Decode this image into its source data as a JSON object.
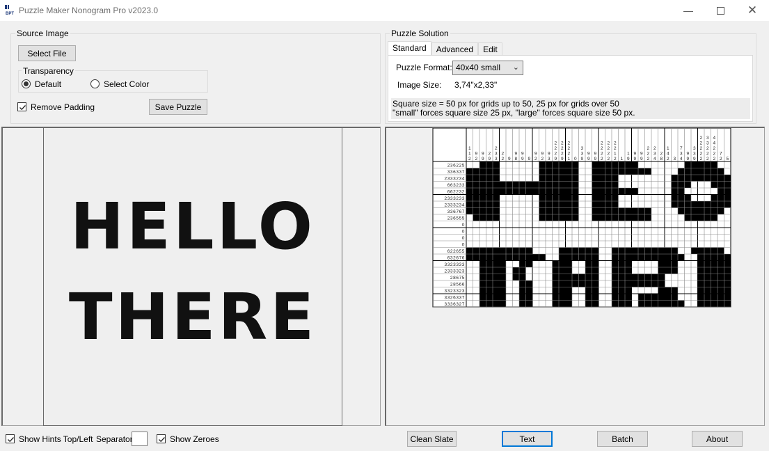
{
  "window": {
    "title": "Puzzle Maker Nonogram Pro v2023.0",
    "icon": "app-logo-icon",
    "icon_text": "BPT",
    "controls": [
      "minimize-icon",
      "maximize-icon",
      "close-icon"
    ]
  },
  "source_image": {
    "group_title": "Source Image",
    "select_file_label": "Select File",
    "transparency": {
      "title": "Transparency",
      "options": [
        {
          "label": "Default",
          "selected": true
        },
        {
          "label": "Select Color",
          "selected": false
        }
      ]
    },
    "remove_padding": {
      "label": "Remove Padding",
      "checked": true
    },
    "save_puzzle_label": "Save Puzzle",
    "preview_text": [
      "HELLO",
      "THERE"
    ]
  },
  "puzzle_solution": {
    "group_title": "Puzzle Solution",
    "tabs": [
      {
        "label": "Standard",
        "active": true
      },
      {
        "label": "Advanced",
        "active": false
      },
      {
        "label": "Edit",
        "active": false
      }
    ],
    "puzzle_format_label": "Puzzle Format:",
    "puzzle_format_value": "40x40 small",
    "image_size_label": "Image Size:",
    "image_size_value": "3,74\"x2,33\"",
    "note_line1": "Square size = 50 px for grids up to 50, 25 px for grids over 50",
    "note_line2": "\"small\" forces square size 25 px, \"large\" forces square size 50 px."
  },
  "nonogram": {
    "cols": 40,
    "row_hints": [
      "236225",
      "336337",
      "2333234",
      "663233",
      "662232",
      "2333233",
      "2333234",
      "336767",
      "236555",
      "0",
      "0",
      "0",
      "0",
      "622655",
      "632676",
      "3323333",
      "2333323",
      "28675",
      "28566",
      "3323323",
      "3326337",
      "3336327"
    ],
    "col_hints": [
      [
        "1",
        "1",
        "2"
      ],
      [
        "9",
        "2"
      ],
      [
        "9",
        "9"
      ],
      [
        "2",
        "9"
      ],
      [
        "2",
        "3",
        "3"
      ],
      [
        "2",
        "2"
      ],
      [
        "9"
      ],
      [
        "9",
        "8"
      ],
      [
        "9",
        "9"
      ],
      [
        "9"
      ],
      [
        "9",
        "2"
      ],
      [
        "9",
        "2"
      ],
      [
        "9",
        "3"
      ],
      [
        "2",
        "2",
        "2",
        "9"
      ],
      [
        "2",
        "2",
        "2",
        "9"
      ],
      [
        "2",
        "2",
        "2",
        "1"
      ],
      [
        "0"
      ],
      [
        "3",
        "3",
        "9"
      ],
      [
        "9",
        "9"
      ],
      [
        "9",
        "9"
      ],
      [
        "2",
        "2",
        "2",
        "2"
      ],
      [
        "2",
        "2",
        "2",
        "2"
      ],
      [
        "2",
        "2",
        "1",
        "2"
      ],
      [
        "1"
      ],
      [
        "1",
        "9"
      ],
      [
        "9",
        "9"
      ],
      [
        "9",
        "9"
      ],
      [
        "2",
        "2",
        "2"
      ],
      [
        "2",
        "3",
        "4"
      ],
      [
        "2",
        "8"
      ],
      [
        "1",
        "4",
        "2"
      ],
      [
        "3"
      ],
      [
        "7",
        "3",
        "4"
      ],
      [
        "9",
        "9"
      ],
      [
        "3",
        "3",
        "9"
      ],
      [
        "2",
        "2",
        "2",
        "2",
        "2"
      ],
      [
        "3",
        "3",
        "2",
        "2",
        "2"
      ],
      [
        "4",
        "4",
        "2",
        "2",
        "2"
      ],
      [
        "7",
        "2"
      ],
      [
        "5"
      ]
    ],
    "grid": [
      "0011100000011111100111111100000001111100",
      "1111100000011111100111111111000011111110",
      "1111100000011111100111100000000111111111",
      "1111111111111111100111100000000111000111",
      "1111111111111111100111111100000110000011",
      "1111100000011111100111100000000111000111",
      "1111100000011111100111100000000111111111",
      "1111100000011111100111111111000011111110",
      "0111100000011111100111111111000001111100",
      "0000000000000000000000000000000000000000",
      "0000000000000000000000000000000000000000",
      "0000000000000000000000000000000000000000",
      "0000000000000000000000000000000000000000",
      "1111111111000011111100111111111100111110",
      "1111111111110011111100111111111110011111",
      "0011110011000111001100111000011100011111",
      "0011110110000111001100111000011100011111",
      "0011110110000111111100111111110000011111",
      "0011110011000111111100111111110000011111",
      "0011110011000111001100111000011100011111",
      "0011110011000111001100111011111100011111",
      "0011110011000111001100111011111110011111"
    ]
  },
  "bottom_bar": {
    "show_hints": {
      "label": "Show Hints Top/Left",
      "checked": true
    },
    "separator_label": "Separator",
    "separator_value": "",
    "show_zeroes": {
      "label": "Show Zeroes",
      "checked": true
    },
    "buttons": [
      "Clean Slate",
      "Text",
      "Batch",
      "About"
    ],
    "focused_button": "Text"
  }
}
